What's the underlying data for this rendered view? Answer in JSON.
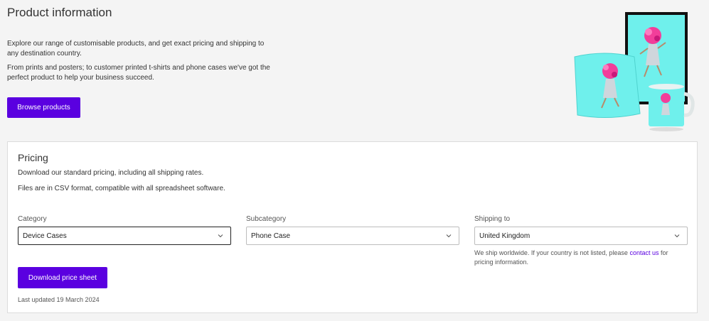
{
  "product_info": {
    "title": "Product information",
    "paragraph_1": "Explore our range of customisable products, and get exact pricing and shipping to any destination country.",
    "paragraph_2": "From prints and posters; to customer printed t-shirts and phone cases we've got the perfect product to help your business succeed.",
    "browse_button": "Browse products"
  },
  "pricing": {
    "title": "Pricing",
    "paragraph_1": "Download our standard pricing, including all shipping rates.",
    "paragraph_2": "Files are in CSV format, compatible with all spreadsheet software.",
    "category": {
      "label": "Category",
      "value": "Device Cases"
    },
    "subcategory": {
      "label": "Subcategory",
      "value": "Phone Case"
    },
    "shipping": {
      "label": "Shipping to",
      "value": "United Kingdom"
    },
    "ship_note_before": "We ship worldwide. If your country is not listed, please ",
    "ship_note_link": "contact us",
    "ship_note_after": " for pricing information.",
    "download_button": "Download price sheet",
    "last_updated": "Last updated 19 March 2024"
  },
  "colors": {
    "accent": "#5a00e0",
    "product_bg": "#6ff0ec"
  }
}
